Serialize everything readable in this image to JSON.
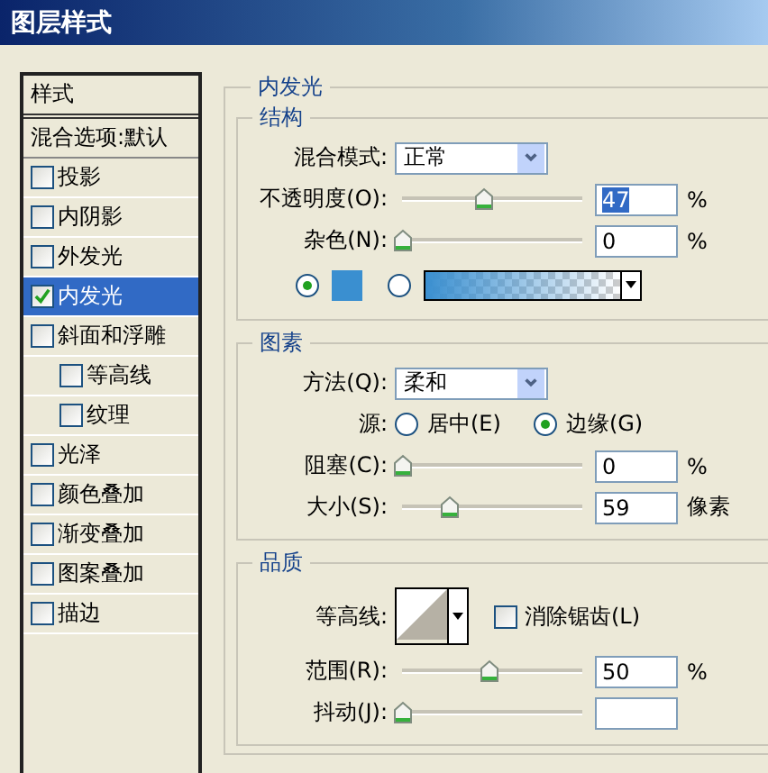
{
  "window": {
    "title": "图层样式"
  },
  "sidebar": {
    "header": "样式",
    "blend_options": "混合选项:默认",
    "items": [
      {
        "label": "投影",
        "checked": false,
        "selected": false
      },
      {
        "label": "内阴影",
        "checked": false,
        "selected": false
      },
      {
        "label": "外发光",
        "checked": false,
        "selected": false
      },
      {
        "label": "内发光",
        "checked": true,
        "selected": true
      },
      {
        "label": "斜面和浮雕",
        "checked": false,
        "selected": false,
        "children": [
          {
            "label": "等高线",
            "checked": false,
            "selected": false
          },
          {
            "label": "纹理",
            "checked": false,
            "selected": false
          }
        ]
      },
      {
        "label": "光泽",
        "checked": false,
        "selected": false
      },
      {
        "label": "颜色叠加",
        "checked": false,
        "selected": false
      },
      {
        "label": "渐变叠加",
        "checked": false,
        "selected": false
      },
      {
        "label": "图案叠加",
        "checked": false,
        "selected": false
      },
      {
        "label": "描边",
        "checked": false,
        "selected": false
      }
    ]
  },
  "panel": {
    "title": "内发光",
    "sections": [
      {
        "title": "结构",
        "rows": [
          {
            "kind": "select",
            "label": "混合模式:",
            "value": "正常"
          },
          {
            "kind": "slider",
            "label": "不透明度(O):",
            "level": 0.47,
            "value": "47",
            "unit": "%",
            "text_selected": true
          },
          {
            "kind": "slider",
            "label": "杂色(N):",
            "level": 0,
            "value": "0",
            "unit": "%",
            "text_selected": false
          },
          {
            "kind": "fill",
            "options": [
              {
                "kind": "color",
                "selected": true,
                "color": "#3a8fd0"
              },
              {
                "kind": "gradient",
                "selected": false,
                "color": "#3a8fd0"
              }
            ]
          }
        ]
      },
      {
        "title": "图素",
        "rows": [
          {
            "kind": "select",
            "label": "方法(Q):",
            "value": "柔和"
          },
          {
            "kind": "radio",
            "label": "源:",
            "options": [
              {
                "label": "居中(E)",
                "selected": false
              },
              {
                "label": "边缘(G)",
                "selected": true
              }
            ]
          },
          {
            "kind": "slider",
            "label": "阻塞(C):",
            "level": 0,
            "value": "0",
            "unit": "%",
            "text_selected": false
          },
          {
            "kind": "slider",
            "label": "大小(S):",
            "level": 0.27,
            "value": "59",
            "unit": "像素",
            "text_selected": false
          }
        ]
      },
      {
        "title": "品质",
        "rows": [
          {
            "kind": "contour",
            "label": "等高线:",
            "checkbox": {
              "label": "消除锯齿(L)",
              "checked": false
            }
          },
          {
            "kind": "slider",
            "label": "范围(R):",
            "level": 0.5,
            "value": "50",
            "unit": "%",
            "text_selected": false
          },
          {
            "kind": "slider",
            "label": "抖动(J):",
            "level": 0
          }
        ]
      }
    ]
  }
}
